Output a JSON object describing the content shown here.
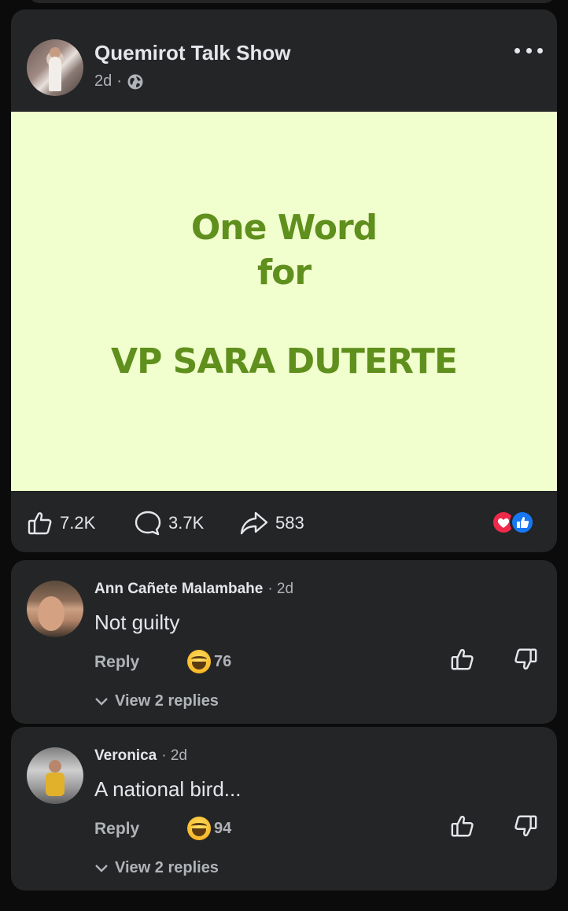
{
  "post": {
    "page_name": "Quemirot Talk Show",
    "time": "2d",
    "separator": "·",
    "image_text": {
      "line1": "One Word",
      "line2": "for",
      "line3": "VP SARA DUTERTE"
    },
    "stats": {
      "likes": "7.2K",
      "comments": "3.7K",
      "shares": "583"
    },
    "reactions": [
      "heart-icon",
      "like-icon"
    ]
  },
  "comments": [
    {
      "name": "Ann Cañete Malambahe",
      "time": "· 2d",
      "text": "Not guilty",
      "reply_label": "Reply",
      "reaction_count": "76",
      "view_replies": "View 2 replies"
    },
    {
      "name": "Veronica",
      "time": "· 2d",
      "text": "A national bird...",
      "reply_label": "Reply",
      "reaction_count": "94",
      "view_replies": "View 2 replies"
    }
  ],
  "colors": {
    "card_bg": "#242526",
    "image_bg": "#f1fecd",
    "image_text": "#5f8f1c",
    "heart": "#f02849",
    "like": "#1877f2"
  }
}
